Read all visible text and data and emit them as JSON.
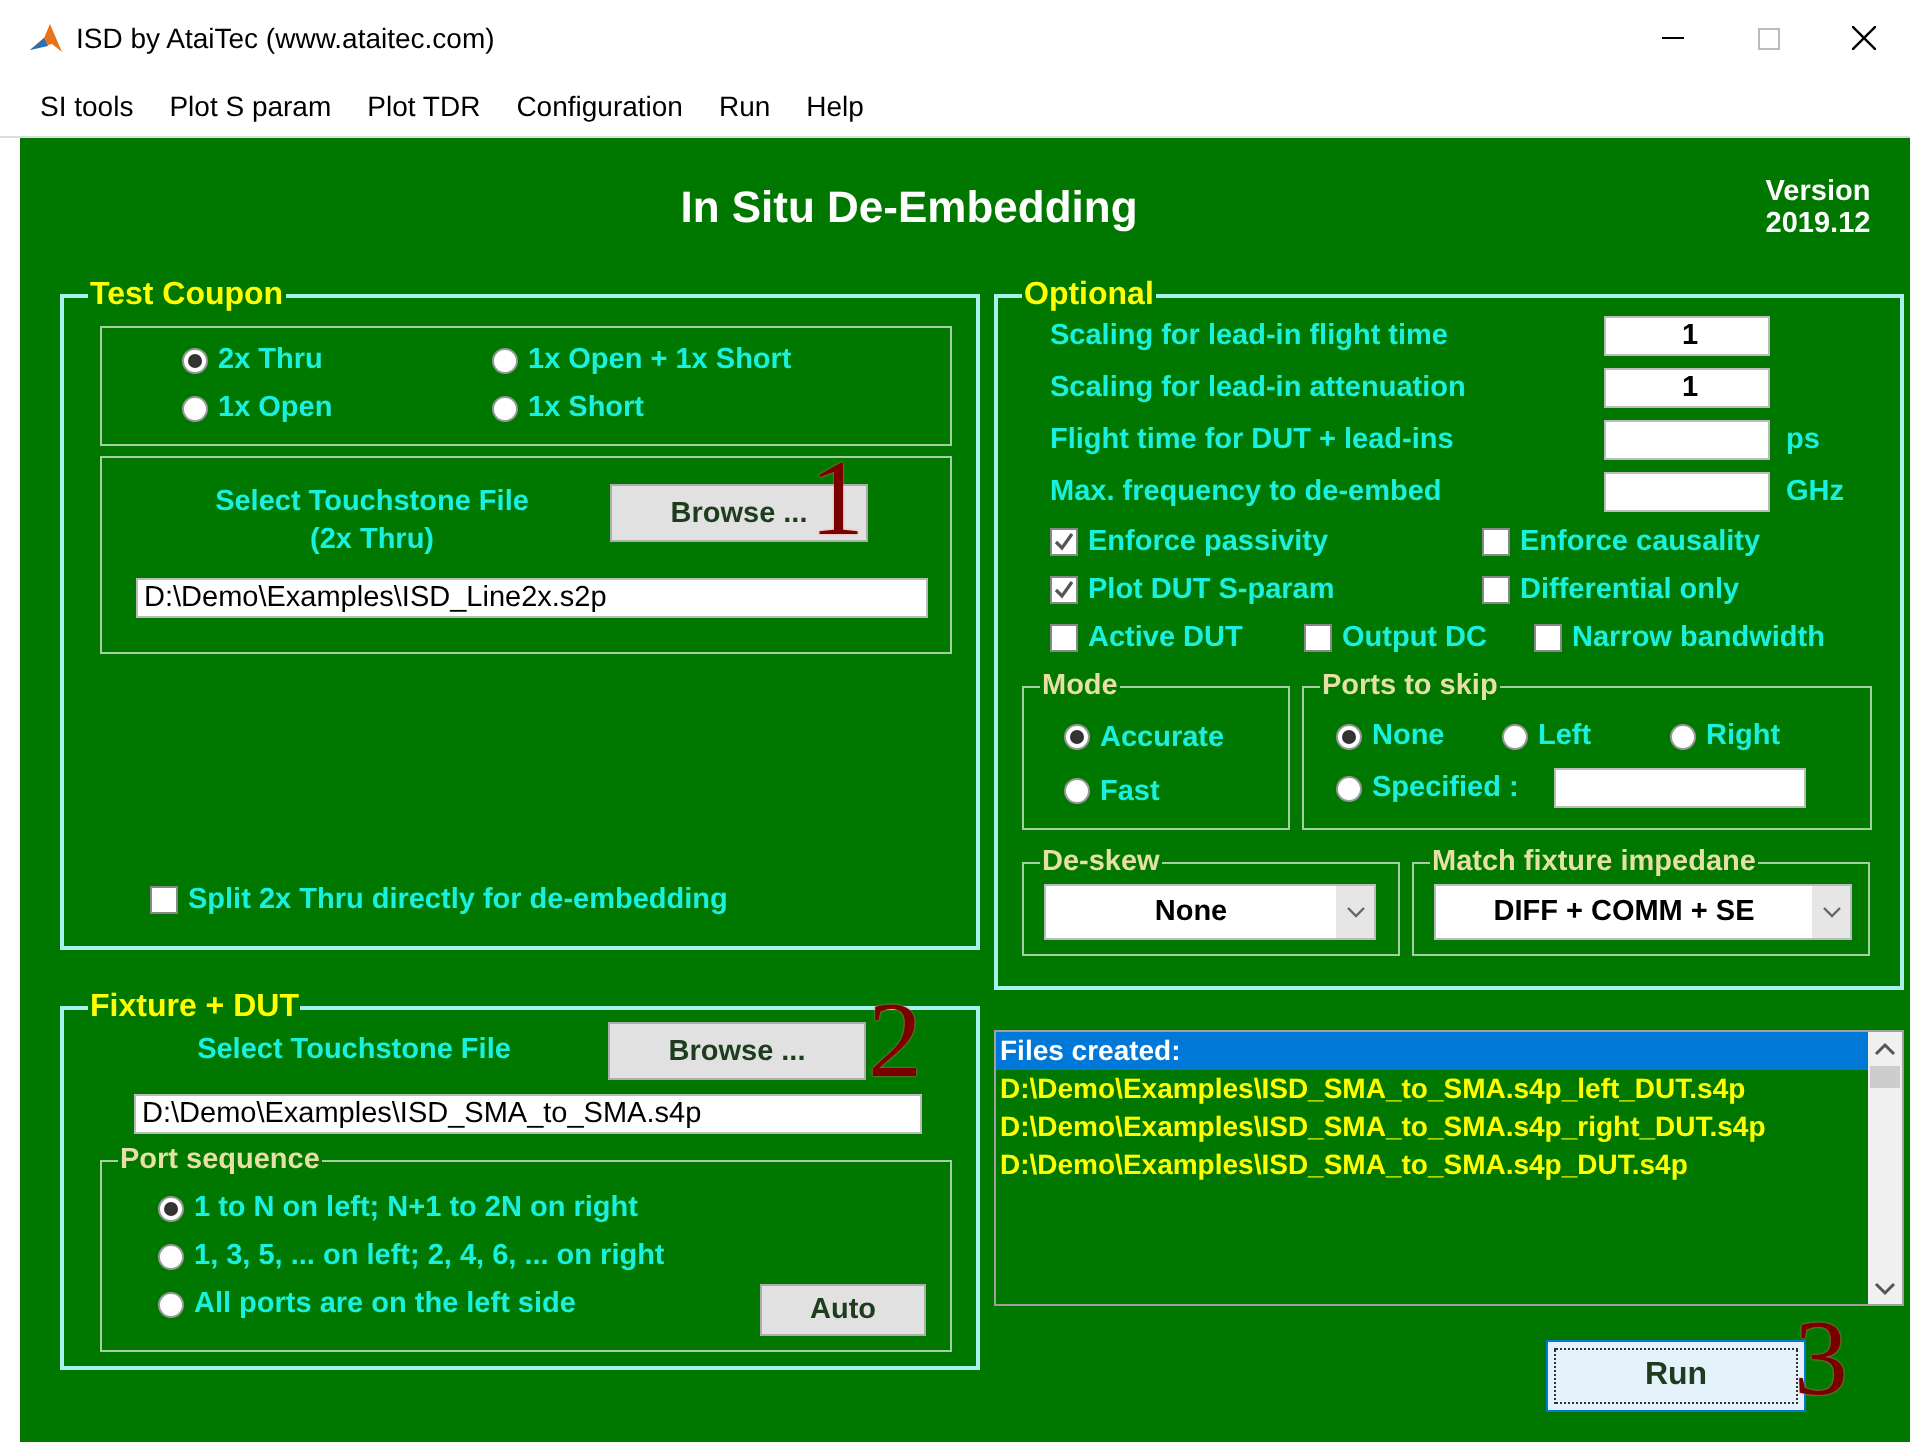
{
  "window": {
    "title": "ISD by AtaiTec (www.ataitec.com)"
  },
  "menu": [
    "SI tools",
    "Plot S param",
    "Plot TDR",
    "Configuration",
    "Run",
    "Help"
  ],
  "header": {
    "title": "In Situ De-Embedding",
    "version_label": "Version",
    "version": "2019.12"
  },
  "test_coupon": {
    "legend": "Test Coupon",
    "options": [
      {
        "label": "2x Thru",
        "selected": true
      },
      {
        "label": "1x Open + 1x Short",
        "selected": false
      },
      {
        "label": "1x Open",
        "selected": false
      },
      {
        "label": "1x Short",
        "selected": false
      }
    ],
    "file_label": "Select Touchstone File",
    "file_sublabel": "(2x Thru)",
    "browse": "Browse ...",
    "marker": "1",
    "file": "D:\\Demo\\Examples\\ISD_Line2x.s2p",
    "split": {
      "label": "Split 2x Thru directly for de-embedding",
      "checked": false
    }
  },
  "fixture_dut": {
    "legend": "Fixture + DUT",
    "file_label": "Select Touchstone File",
    "browse": "Browse ...",
    "marker": "2",
    "file": "D:\\Demo\\Examples\\ISD_SMA_to_SMA.s4p",
    "port_sequence": {
      "legend": "Port sequence",
      "options": [
        {
          "label": "1 to N on left; N+1 to 2N on right",
          "selected": true
        },
        {
          "label": "1, 3, 5, ... on left; 2, 4, 6, ... on right",
          "selected": false
        },
        {
          "label": "All ports are on the left side",
          "selected": false
        }
      ],
      "auto": "Auto"
    }
  },
  "optional": {
    "legend": "Optional",
    "fields": [
      {
        "label": "Scaling for lead-in flight time",
        "value": "1"
      },
      {
        "label": "Scaling for lead-in attenuation",
        "value": "1"
      },
      {
        "label": "Flight time for DUT + lead-ins",
        "unit": "ps"
      },
      {
        "label": "Max. frequency to de-embed",
        "unit": "GHz"
      }
    ],
    "checkbox_rows": [
      [
        {
          "label": "Enforce passivity",
          "checked": true
        },
        {
          "label": "Enforce causality",
          "checked": false
        }
      ],
      [
        {
          "label": "Plot DUT S-param",
          "checked": true
        },
        {
          "label": "Differential only",
          "checked": false
        }
      ],
      [
        {
          "label": "Active DUT",
          "checked": false
        },
        {
          "label": "Output DC",
          "checked": false
        },
        {
          "label": "Narrow bandwidth",
          "checked": false
        }
      ]
    ],
    "mode": {
      "legend": "Mode",
      "options": [
        {
          "label": "Accurate",
          "selected": true
        },
        {
          "label": "Fast",
          "selected": false
        }
      ]
    },
    "ports_to_skip": {
      "legend": "Ports to skip",
      "options": [
        {
          "label": "None",
          "selected": true
        },
        {
          "label": "Left",
          "selected": false
        },
        {
          "label": "Right",
          "selected": false
        },
        {
          "label": "Specified :",
          "selected": false
        }
      ]
    },
    "deskew": {
      "legend": "De-skew",
      "value": "None"
    },
    "match_impedance": {
      "legend": "Match fixture impedane",
      "value": "DIFF + COMM + SE"
    }
  },
  "files_created": [
    {
      "text": "Files created:",
      "selected": true
    },
    {
      "text": "D:\\Demo\\Examples\\ISD_SMA_to_SMA.s4p_left_DUT.s4p",
      "selected": false
    },
    {
      "text": "D:\\Demo\\Examples\\ISD_SMA_to_SMA.s4p_right_DUT.s4p",
      "selected": false
    },
    {
      "text": "D:\\Demo\\Examples\\ISD_SMA_to_SMA.s4p_DUT.s4p",
      "selected": false
    }
  ],
  "run": {
    "label": "Run",
    "marker": "3"
  }
}
